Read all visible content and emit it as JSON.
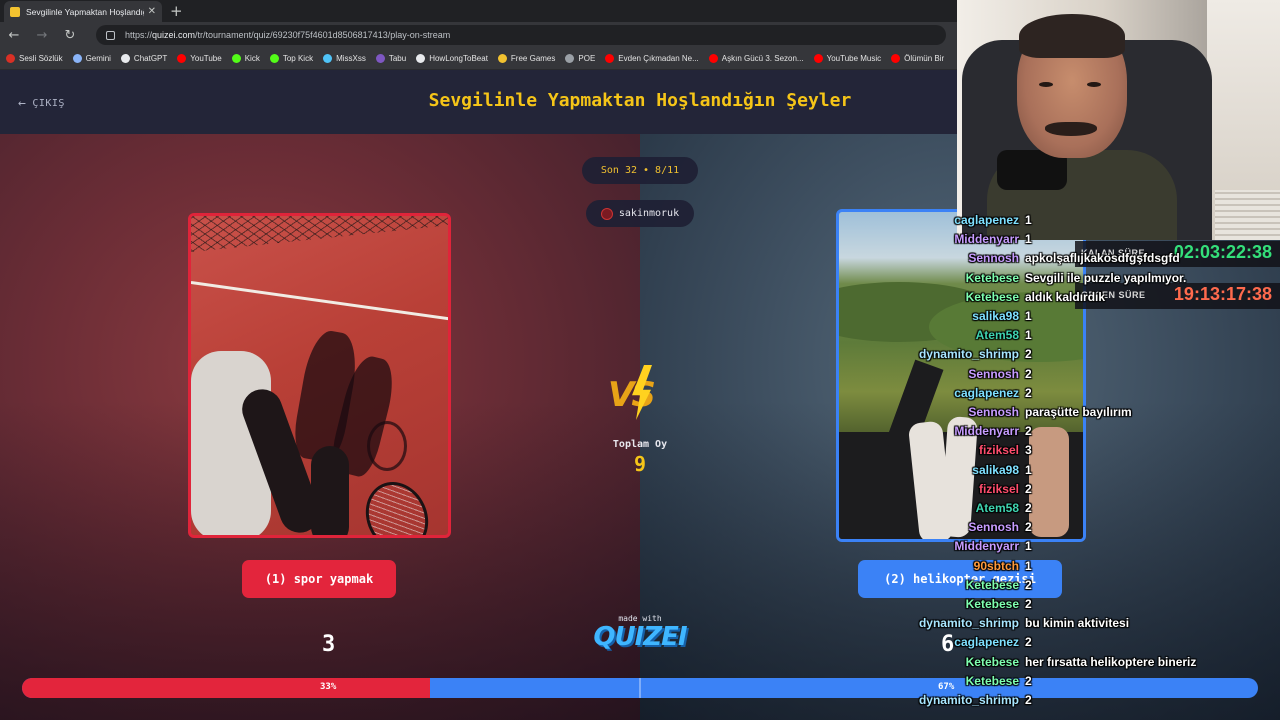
{
  "browser": {
    "tab_title": "Sevgilinle Yapmaktan Hoşlandığın Şeyler",
    "url_host": "quizei.com",
    "url_path": "/tr/tournament/quiz/69230f75f4601d8506817413/play-on-stream",
    "url_prefix": "https://",
    "bookmarks": [
      {
        "label": "Sesli Sözlük",
        "color": "#d93025"
      },
      {
        "label": "Gemini",
        "color": "#8ab4f8"
      },
      {
        "label": "ChatGPT",
        "color": "#e8eaed"
      },
      {
        "label": "YouTube",
        "color": "#ff0000"
      },
      {
        "label": "Kick",
        "color": "#53fc18"
      },
      {
        "label": "Top Kick",
        "color": "#53fc18"
      },
      {
        "label": "MissXss",
        "color": "#4fc3f7"
      },
      {
        "label": "Tabu",
        "color": "#7e57c2"
      },
      {
        "label": "HowLongToBeat",
        "color": "#e8eaed"
      },
      {
        "label": "Free Games",
        "color": "#f2c230"
      },
      {
        "label": "POE",
        "color": "#9aa0a6"
      },
      {
        "label": "Evden Çıkmadan Ne...",
        "color": "#ff0000"
      },
      {
        "label": "Aşkın Gücü 3. Sezon...",
        "color": "#ff0000"
      },
      {
        "label": "YouTube Music",
        "color": "#ff0000"
      },
      {
        "label": "Ölümün Bir",
        "color": "#ff0000"
      }
    ]
  },
  "quiz": {
    "exit_label": "ÇIKIŞ",
    "title": "Sevgilinle Yapmaktan Hoşlandığın Şeyler",
    "round_label": "Son 32 • 8/11",
    "username": "sakinmoruk",
    "vs_label": "VS",
    "total_votes_label": "Toplam Oy",
    "total_votes": "9",
    "made_with": "made with",
    "brand": "QUIZEI",
    "option_left": {
      "label": "(1) spor yapmak",
      "votes": "3",
      "percent_label": "33%",
      "percent": 33
    },
    "option_right": {
      "label": "(2) helikopter gezisi",
      "votes": "6",
      "percent_label": "67%",
      "percent": 67
    },
    "colors": {
      "left": "#e3253c",
      "right": "#3b82f6",
      "accent": "#f5c518"
    }
  },
  "timers": [
    {
      "label": "KALAN SÜRE",
      "value": "02:03:22:38",
      "color": "#34e07a"
    },
    {
      "label": "GEÇEN SÜRE",
      "value": "19:13:17:38",
      "color": "#ff6a4d"
    }
  ],
  "chat": [
    {
      "user": "caglapenez",
      "color": "#7ee0ff",
      "msg": "1"
    },
    {
      "user": "Middenyarr",
      "color": "#c79cff",
      "msg": "1"
    },
    {
      "user": "Sennosh",
      "color": "#c79cff",
      "msg": "apkolşaflıjkakösdfgşfdsgfd"
    },
    {
      "user": "Ketebese",
      "color": "#7fffb0",
      "msg": "Sevgili ile puzzle yapılmıyor."
    },
    {
      "user": "Ketebese",
      "color": "#7fffb0",
      "msg": "aldık kaldırdık"
    },
    {
      "user": "salika98",
      "color": "#7ee0ff",
      "msg": "1"
    },
    {
      "user": "Atem58",
      "color": "#3fd4b0",
      "msg": "1"
    },
    {
      "user": "dynamito_shrimp",
      "color": "#a8e6ff",
      "msg": "2"
    },
    {
      "user": "Sennosh",
      "color": "#c79cff",
      "msg": "2"
    },
    {
      "user": "caglapenez",
      "color": "#7ee0ff",
      "msg": "2"
    },
    {
      "user": "Sennosh",
      "color": "#c79cff",
      "msg": "paraşütte bayılırım"
    },
    {
      "user": "Middenyarr",
      "color": "#c79cff",
      "msg": "2"
    },
    {
      "user": "fiziksel",
      "color": "#ff4d6d",
      "msg": "3"
    },
    {
      "user": "salika98",
      "color": "#7ee0ff",
      "msg": "1"
    },
    {
      "user": "fiziksel",
      "color": "#ff4d6d",
      "msg": "2"
    },
    {
      "user": "Atem58",
      "color": "#3fd4b0",
      "msg": "2"
    },
    {
      "user": "Sennosh",
      "color": "#c79cff",
      "msg": "2"
    },
    {
      "user": "Middenyarr",
      "color": "#c79cff",
      "msg": "1"
    },
    {
      "user": "90sbtch",
      "color": "#ff9a3d",
      "msg": "1"
    },
    {
      "user": "Ketebese",
      "color": "#7fffb0",
      "msg": "2"
    },
    {
      "user": "Ketebese",
      "color": "#7fffb0",
      "msg": "2"
    },
    {
      "user": "dynamito_shrimp",
      "color": "#a8e6ff",
      "msg": "bu kimin aktivitesi"
    },
    {
      "user": "caglapenez",
      "color": "#7ee0ff",
      "msg": "2"
    },
    {
      "user": "Ketebese",
      "color": "#7fffb0",
      "msg": "her fırsatta helikoptere bineriz"
    },
    {
      "user": "Ketebese",
      "color": "#7fffb0",
      "msg": "2"
    },
    {
      "user": "dynamito_shrimp",
      "color": "#a8e6ff",
      "msg": "2"
    }
  ]
}
